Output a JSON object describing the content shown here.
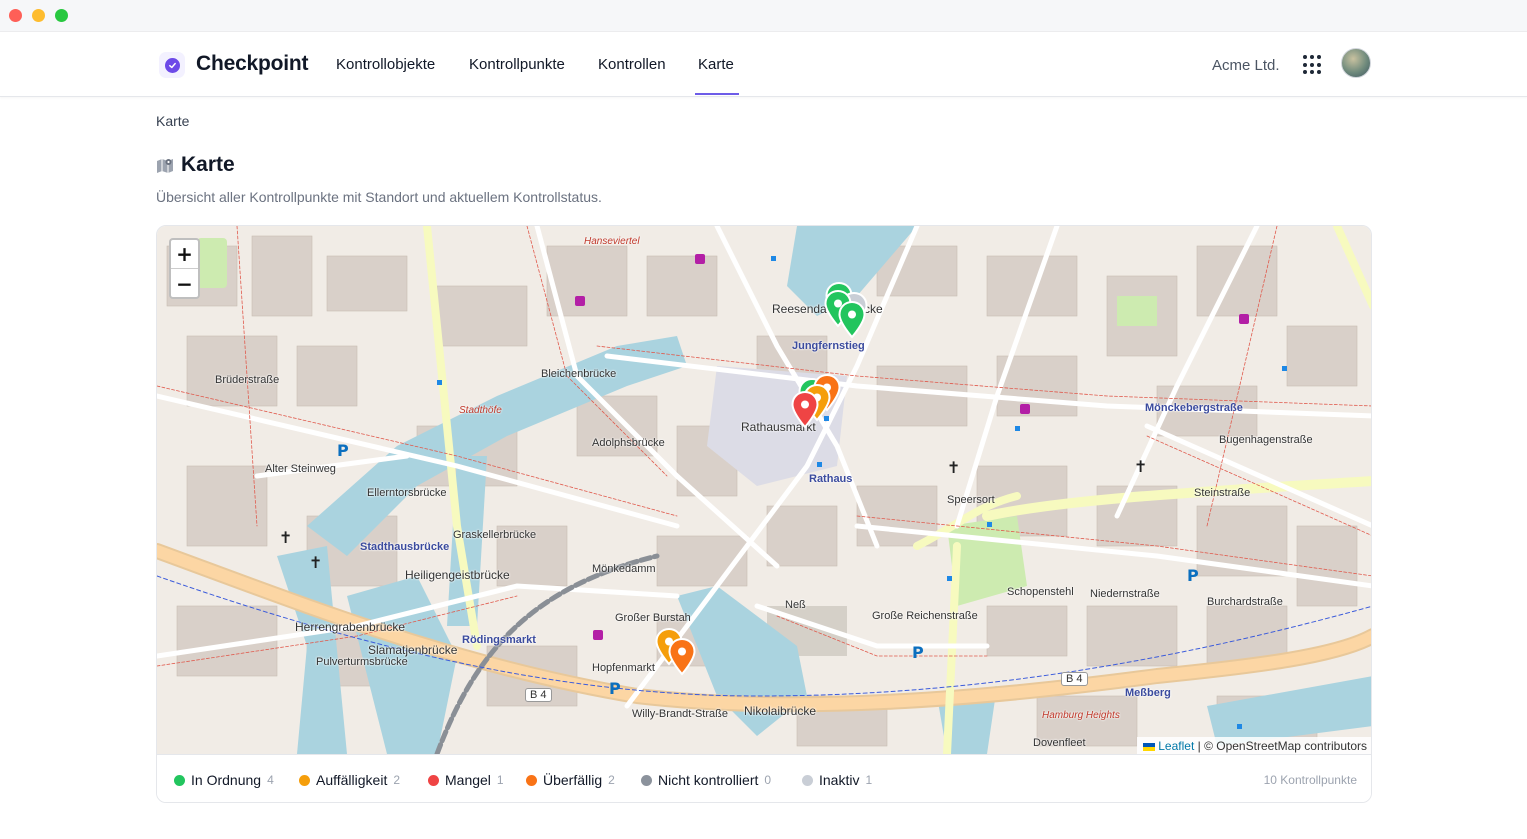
{
  "app": {
    "brand": "Checkpoint",
    "company": "Acme Ltd."
  },
  "nav": [
    {
      "label": "Kontrollobjekte",
      "active": false
    },
    {
      "label": "Kontrollpunkte",
      "active": false
    },
    {
      "label": "Kontrollen",
      "active": false
    },
    {
      "label": "Karte",
      "active": true
    }
  ],
  "breadcrumb": "Karte",
  "page": {
    "title": "Karte",
    "subtitle": "Übersicht aller Kontrollpunkte mit Standort und aktuellem Kontrollstatus."
  },
  "map": {
    "zoom_in": "+",
    "zoom_out": "−",
    "attribution_leaflet": "Leaflet",
    "attribution_osm": "| © OpenStreetMap contributors",
    "labels": [
      "Reesendammbrücke",
      "Jungfernstieg",
      "Rathausmarkt",
      "Rathaus",
      "Mönckebergstraße",
      "Stadthausbrücke",
      "Bleichenbrücke",
      "Adolphsbrücke",
      "Alter Steinweg",
      "Ellerntorsbrücke",
      "Graskellerbrücke",
      "Heiligengeistbrücke",
      "Herrengrabenbrücke",
      "Slamatjenbrücke",
      "Pulverturmsbrücke",
      "Rödingsmarkt",
      "Hopfenmarkt",
      "Willy-Brandt-Straße",
      "Nikolaibrücke",
      "Neß",
      "Großer Burstah",
      "Große Reichenstraße",
      "Schopenstehl",
      "Niedernstraße",
      "Steinstraße",
      "Speersort",
      "Bugenhagenstraße",
      "Burchardstraße",
      "Meßberg",
      "Dovenfleet",
      "Hamburg Heights",
      "Hanseviertel",
      "Stadthöfe",
      "Mönkedamm",
      "Brüderstraße",
      "B 4"
    ],
    "markers": [
      {
        "status": "ok",
        "color": "#22c55e"
      },
      {
        "status": "ok",
        "color": "#22c55e"
      },
      {
        "status": "ok",
        "color": "#22c55e"
      },
      {
        "status": "ok",
        "color": "#22c55e"
      },
      {
        "status": "inactive",
        "color": "#c9ced6"
      },
      {
        "status": "issue",
        "color": "#f59e0b"
      },
      {
        "status": "issue",
        "color": "#f59e0b"
      },
      {
        "status": "defect",
        "color": "#ef4444"
      },
      {
        "status": "overdue",
        "color": "#f97316"
      },
      {
        "status": "overdue",
        "color": "#f97316"
      }
    ]
  },
  "legend": {
    "items": [
      {
        "label": "In Ordnung",
        "count": "4",
        "color": "#22c55e"
      },
      {
        "label": "Auffälligkeit",
        "count": "2",
        "color": "#f59e0b"
      },
      {
        "label": "Mangel",
        "count": "1",
        "color": "#ef4444"
      },
      {
        "label": "Überfällig",
        "count": "2",
        "color": "#f97316"
      },
      {
        "label": "Nicht kontrolliert",
        "count": "0",
        "color": "#8b929c"
      },
      {
        "label": "Inaktiv",
        "count": "1",
        "color": "#c9ced6"
      }
    ],
    "total": "10 Kontrollpunkte"
  }
}
